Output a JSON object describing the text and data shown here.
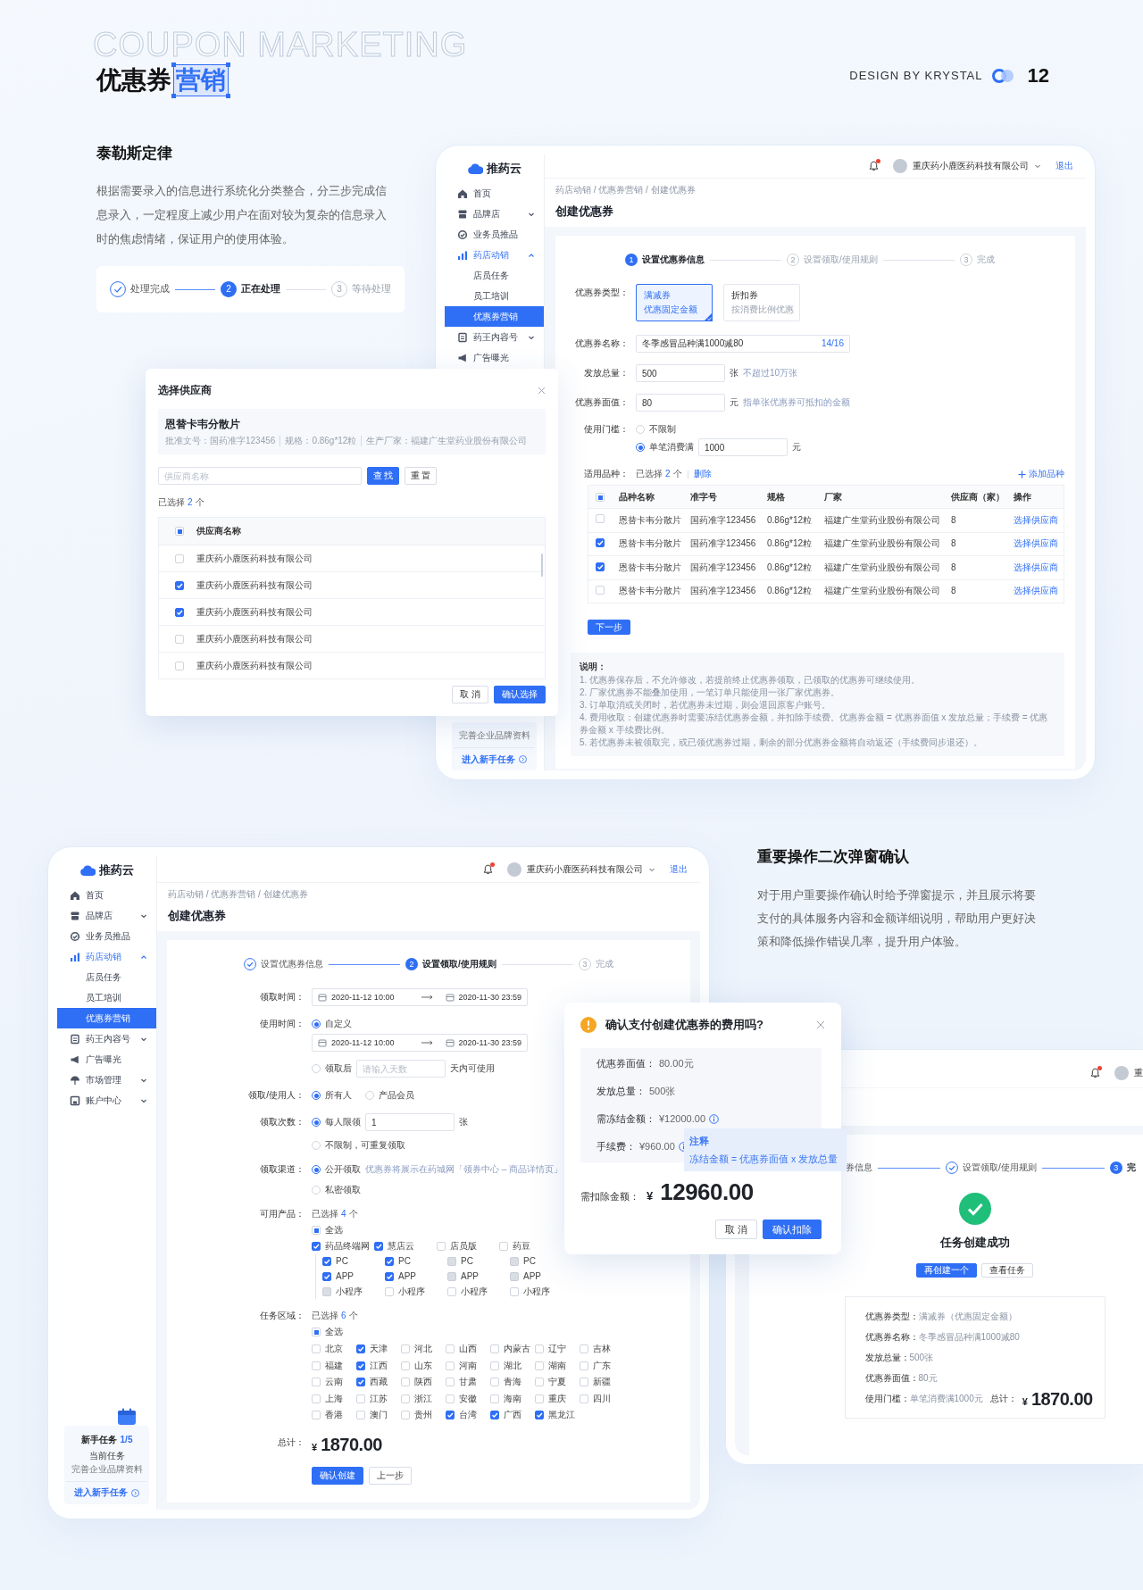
{
  "header": {
    "bg_title": "COUPON MARKETING",
    "title": "优惠券",
    "title_highlight": "营销",
    "credit": "DESIGN BY KRYSTAL",
    "page_number": "12"
  },
  "intro": {
    "heading": "泰勒斯定律",
    "text": "根据需要录入的信息进行系统化分类整合，分三步完成信息录入，一定程度上减少用户在面对较为复杂的信息录入时的焦虑情绪，保证用户的使用体验。",
    "steps": [
      {
        "label": "处理完成",
        "done": true,
        "active": false
      },
      {
        "number": "2",
        "label": "正在处理",
        "done": false,
        "active": true
      },
      {
        "number": "3",
        "label": "等待处理",
        "done": false,
        "active": false
      }
    ]
  },
  "create_window": {
    "logo": "推药云",
    "nav": [
      {
        "label": "首页",
        "kind": "link",
        "selected": false
      },
      {
        "label": "品牌店",
        "kind": "group",
        "expanded": false,
        "selected": false
      },
      {
        "label": "业务员推品",
        "kind": "link",
        "selected": false
      },
      {
        "label": "药店动销",
        "kind": "group",
        "expanded": true,
        "selected": false,
        "children": [
          {
            "label": "店员任务",
            "selected": false
          },
          {
            "label": "员工培训",
            "selected": false
          },
          {
            "label": "优惠券营销",
            "selected": true
          }
        ]
      },
      {
        "label": "药王内容号",
        "kind": "group",
        "expanded": false,
        "selected": false
      },
      {
        "label": "广告曝光",
        "kind": "link",
        "selected": false
      }
    ],
    "newbie": {
      "current_task": "完善企业品牌资料",
      "link": "进入新手任务"
    },
    "user": {
      "notification": true,
      "company": "重庆药小鹿医药科技有限公司",
      "logout": "退出"
    },
    "breadcrumb": "药店动销 / 优惠券营销 / 创建优惠券",
    "title": "创建优惠券",
    "steps": [
      {
        "number": "1",
        "label": "设置优惠券信息",
        "done": false,
        "active": true
      },
      {
        "number": "2",
        "label": "设置领取/使用规则",
        "done": false,
        "active": false
      },
      {
        "number": "3",
        "label": "完成",
        "done": false,
        "active": false
      }
    ],
    "coupon_type": {
      "label": "优惠券类型：",
      "options": [
        {
          "title": "满减券",
          "desc": "优惠固定金额",
          "selected": true
        },
        {
          "title": "折扣券",
          "desc": "按消费比例优惠",
          "selected": false
        }
      ]
    },
    "name_field": {
      "label": "优惠券名称：",
      "value": "冬季感冒品种满1000减80",
      "counter": "14/16"
    },
    "total_field": {
      "label": "发放总量：",
      "value": "500",
      "unit": "张",
      "hint": "不超过10万张"
    },
    "face_field": {
      "label": "优惠券面值：",
      "value": "80",
      "unit": "元",
      "hint": "指单张优惠券可抵扣的金额"
    },
    "threshold": {
      "label": "使用门槛：",
      "none": {
        "label": "不限制",
        "selected": false
      },
      "min": {
        "label": "单笔消费满",
        "selected": true,
        "value": "1000",
        "unit": "元"
      }
    },
    "products": {
      "label": "适用品种：",
      "selected": {
        "prefix": "已选择",
        "count": "2",
        "suffix": "个"
      },
      "delete": "删除",
      "add": "添加品种",
      "header_indeterminate": true,
      "columns": [
        "品种名称",
        "准字号",
        "规格",
        "厂家",
        "供应商（家）",
        "操作"
      ],
      "rows": [
        {
          "checked": false,
          "cells": [
            "恩替卡韦分散片",
            "国药准字123456",
            "0.86g*12粒",
            "福建广生堂药业股份有限公司",
            "8"
          ],
          "action": "选择供应商"
        },
        {
          "checked": true,
          "cells": [
            "恩替卡韦分散片",
            "国药准字123456",
            "0.86g*12粒",
            "福建广生堂药业股份有限公司",
            "8"
          ],
          "action": "选择供应商"
        },
        {
          "checked": true,
          "cells": [
            "恩替卡韦分散片",
            "国药准字123456",
            "0.86g*12粒",
            "福建广生堂药业股份有限公司",
            "8"
          ],
          "action": "选择供应商"
        },
        {
          "checked": false,
          "cells": [
            "恩替卡韦分散片",
            "国药准字123456",
            "0.86g*12粒",
            "福建广生堂药业股份有限公司",
            "8"
          ],
          "action": "选择供应商"
        }
      ]
    },
    "next_button": "下一步",
    "notes": {
      "title": "说明：",
      "lines": [
        "1. 优惠券保存后，不允许修改，若提前终止优惠券领取，已领取的优惠券可继续使用。",
        "2. 厂家优惠券不能叠加使用，一笔订单只能使用一张厂家优惠券。",
        "3. 订单取消或关闭时，若优惠券未过期，则会退回原客户账号。",
        "4. 费用收取：创建优惠券时需要冻结优惠券金额，并扣除手续费。优惠券金额 = 优惠券面值 x 发放总量；手续费 = 优惠券金额 x 手续费比例。",
        "5. 若优惠券未被领取完，或已领优惠券过期，剩余的部分优惠券金额将自动返还（手续费同步退还）。"
      ]
    }
  },
  "supplier_dialog": {
    "title": "选择供应商",
    "drug_name": "恩替卡韦分散片",
    "meta": [
      "批准文号：国药准字123456",
      "规格：0.86g*12粒",
      "生产厂家：福建广生堂药业股份有限公司"
    ],
    "search_placeholder": "供应商名称",
    "search_button": "查 找",
    "reset_button": "重 置",
    "selected": {
      "prefix": "已选择",
      "count": "2",
      "suffix": "个"
    },
    "header_indeterminate": true,
    "column": "供应商名称",
    "rows": [
      {
        "name": "重庆药小鹿医药科技有限公司",
        "checked": false
      },
      {
        "name": "重庆药小鹿医药科技有限公司",
        "checked": true
      },
      {
        "name": "重庆药小鹿医药科技有限公司",
        "checked": true
      },
      {
        "name": "重庆药小鹿医药科技有限公司",
        "checked": false
      },
      {
        "name": "重庆药小鹿医药科技有限公司",
        "checked": false
      }
    ],
    "cancel": "取 消",
    "confirm": "确认选择"
  },
  "rules_window": {
    "logo": "推药云",
    "nav": [
      {
        "label": "首页",
        "kind": "link",
        "selected": false
      },
      {
        "label": "品牌店",
        "kind": "group",
        "expanded": false,
        "selected": false
      },
      {
        "label": "业务员推品",
        "kind": "link",
        "selected": false
      },
      {
        "label": "药店动销",
        "kind": "group",
        "expanded": true,
        "selected": false,
        "children": [
          {
            "label": "店员任务",
            "selected": false
          },
          {
            "label": "员工培训",
            "selected": false
          },
          {
            "label": "优惠券营销",
            "selected": true
          }
        ]
      },
      {
        "label": "药王内容号",
        "kind": "group",
        "expanded": false,
        "selected": false
      },
      {
        "label": "广告曝光",
        "kind": "link",
        "selected": false
      },
      {
        "label": "市场管理",
        "kind": "group",
        "expanded": false,
        "selected": false
      },
      {
        "label": "账户中心",
        "kind": "group",
        "expanded": false,
        "selected": false
      }
    ],
    "newbie": {
      "title": "新手任务",
      "progress": "1/5",
      "current_label": "当前任务",
      "current_task": "完善企业品牌资料",
      "link": "进入新手任务"
    },
    "user": {
      "notification": true,
      "company": "重庆药小鹿医药科技有限公司",
      "logout": "退出"
    },
    "breadcrumb": "药店动销 / 优惠券营销 / 创建优惠券",
    "title": "创建优惠券",
    "steps": [
      {
        "label": "设置优惠券信息",
        "done": true,
        "active": false
      },
      {
        "number": "2",
        "label": "设置领取/使用规则",
        "done": false,
        "active": true
      },
      {
        "number": "3",
        "label": "完成",
        "done": false,
        "active": false
      }
    ],
    "claim_time": {
      "label": "领取时间：",
      "start": "2020-11-12 10:00",
      "end": "2020-11-30 23:59"
    },
    "use_time": {
      "label": "使用时间：",
      "custom": {
        "label": "自定义",
        "selected": true,
        "start": "2020-11-12 10:00",
        "end": "2020-11-30 23:59"
      },
      "after": {
        "label": "领取后",
        "selected": false,
        "placeholder": "请输入天数",
        "suffix": "天内可使用"
      }
    },
    "users": {
      "label": "领取/使用人：",
      "options": [
        {
          "label": "所有人",
          "selected": true
        },
        {
          "label": "产品会员",
          "selected": false
        }
      ]
    },
    "limit": {
      "label": "领取次数：",
      "per_person": {
        "label": "每人限领",
        "selected": true,
        "value": "1",
        "unit": "张"
      },
      "unlimited": {
        "label": "不限制，可重复领取",
        "selected": false
      }
    },
    "channel": {
      "label": "领取渠道：",
      "public": {
        "label": "公开领取",
        "selected": true,
        "hint": "优惠券将展示在药城网「领券中心 – 商品详情页」"
      },
      "private": {
        "label": "私密领取",
        "selected": false
      }
    },
    "products": {
      "label": "可用产品：",
      "selected": {
        "prefix": "已选择",
        "count": "4",
        "suffix": "个"
      },
      "all": {
        "label": "全选",
        "indeterminate": true
      },
      "groups": [
        {
          "label": "药品终端网",
          "checked": true,
          "platforms": [
            {
              "label": "PC",
              "checked": true,
              "disabled": false
            },
            {
              "label": "APP",
              "checked": true,
              "disabled": false
            },
            {
              "label": "小程序",
              "checked": false,
              "disabled": true
            }
          ]
        },
        {
          "label": "慧店云",
          "checked": true,
          "platforms": [
            {
              "label": "PC",
              "checked": true,
              "disabled": false
            },
            {
              "label": "APP",
              "checked": true,
              "disabled": false
            },
            {
              "label": "小程序",
              "checked": false,
              "disabled": false
            }
          ]
        },
        {
          "label": "店员版",
          "checked": false,
          "platforms": [
            {
              "label": "PC",
              "checked": false,
              "disabled": true
            },
            {
              "label": "APP",
              "checked": false,
              "disabled": true
            },
            {
              "label": "小程序",
              "checked": false,
              "disabled": false
            }
          ]
        },
        {
          "label": "药豆",
          "checked": false,
          "platforms": [
            {
              "label": "PC",
              "checked": false,
              "disabled": true
            },
            {
              "label": "APP",
              "checked": false,
              "disabled": true
            },
            {
              "label": "小程序",
              "checked": false,
              "disabled": false
            }
          ]
        }
      ]
    },
    "regions": {
      "label": "任务区域：",
      "selected": {
        "prefix": "已选择",
        "count": "6",
        "suffix": "个"
      },
      "all": {
        "label": "全选",
        "indeterminate": true
      },
      "rows": [
        [
          {
            "label": "北京",
            "checked": false
          },
          {
            "label": "天津",
            "checked": true
          },
          {
            "label": "河北",
            "checked": false
          },
          {
            "label": "山西",
            "checked": false
          },
          {
            "label": "内蒙古",
            "checked": false
          },
          {
            "label": "辽宁",
            "checked": false
          },
          {
            "label": "吉林",
            "checked": false
          }
        ],
        [
          {
            "label": "福建",
            "checked": false
          },
          {
            "label": "江西",
            "checked": true
          },
          {
            "label": "山东",
            "checked": false
          },
          {
            "label": "河南",
            "checked": false
          },
          {
            "label": "湖北",
            "checked": false
          },
          {
            "label": "湖南",
            "checked": false
          },
          {
            "label": "广东",
            "checked": false
          }
        ],
        [
          {
            "label": "云南",
            "checked": false
          },
          {
            "label": "西藏",
            "checked": true
          },
          {
            "label": "陕西",
            "checked": false
          },
          {
            "label": "甘肃",
            "checked": false
          },
          {
            "label": "青海",
            "checked": false
          },
          {
            "label": "宁夏",
            "checked": false
          },
          {
            "label": "新疆",
            "checked": false
          }
        ],
        [
          {
            "label": "上海",
            "checked": false
          },
          {
            "label": "江苏",
            "checked": false
          },
          {
            "label": "浙江",
            "checked": false
          },
          {
            "label": "安徽",
            "checked": false
          },
          {
            "label": "海南",
            "checked": false
          },
          {
            "label": "重庆",
            "checked": false
          },
          {
            "label": "四川",
            "checked": false
          }
        ],
        [
          {
            "label": "香港",
            "checked": false
          },
          {
            "label": "澳门",
            "checked": false
          },
          {
            "label": "贵州",
            "checked": false
          },
          {
            "label": "台湾",
            "checked": true
          },
          {
            "label": "广西",
            "checked": true
          },
          {
            "label": "黑龙江",
            "checked": true
          }
        ]
      ]
    },
    "total": {
      "label": "总计：",
      "currency": "¥",
      "amount": "1870.00"
    },
    "confirm": "确认创建",
    "back": "上一步"
  },
  "feature": {
    "heading": "重要操作二次弹窗确认",
    "text": "对于用户重要操作确认时给予弹窗提示，并且展示将要支付的具体服务内容和金额详细说明，帮助用户更好决策和降低操作错误几率，提升用户体验。"
  },
  "confirm_dialog": {
    "title": "确认支付创建优惠券的费用吗?",
    "items": [
      {
        "label": "优惠券面值：",
        "value": "80.00元",
        "info": false
      },
      {
        "label": "发放总量：",
        "value": "500张",
        "info": false
      },
      {
        "label": "需冻结金额：",
        "value": "¥12000.00",
        "info": true
      },
      {
        "label": "手续费：",
        "value": "¥960.00",
        "info": true
      }
    ],
    "tooltip": {
      "title": "注释",
      "text": "冻结金额 = 优惠券面值 x 发放总量"
    },
    "total_label": "需扣除金额：",
    "currency": "¥",
    "amount": "12960.00",
    "cancel": "取 消",
    "confirm": "确认扣除"
  },
  "success_window": {
    "user": {
      "notification": true,
      "company": "重"
    },
    "cut_step": "券信息",
    "steps": [
      {
        "label": "设置领取/使用规则",
        "done": true,
        "active": false
      },
      {
        "number": "3",
        "label": "完",
        "done": false,
        "active": true
      }
    ],
    "message": "任务创建成功",
    "again_button": "再创建一个",
    "view_button": "查看任务",
    "summary": [
      {
        "label": "优惠券类型：",
        "value": "满减券（优惠固定金额）"
      },
      {
        "label": "优惠券名称：",
        "value": "冬季感冒品种满1000减80"
      },
      {
        "label": "发放总量：",
        "value": "500张"
      },
      {
        "label": "优惠券面值：",
        "value": "80元"
      },
      {
        "label": "使用门槛：",
        "value": "单笔消费满1000元"
      }
    ],
    "total": {
      "label": "总计：",
      "currency": "¥",
      "amount": "1870.00"
    }
  }
}
